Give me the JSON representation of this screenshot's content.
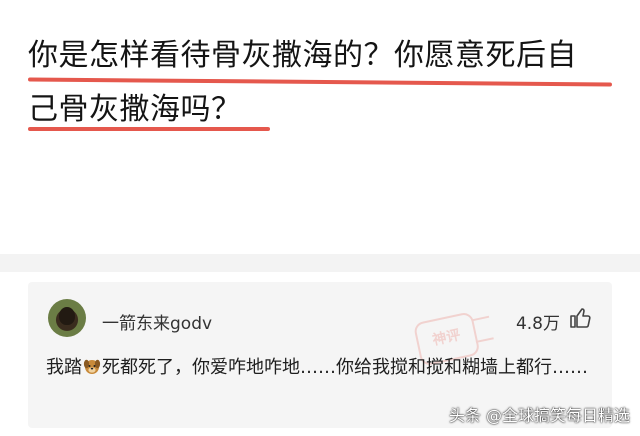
{
  "question": {
    "line1": "你是怎样看待骨灰撒海的？你愿意死后自",
    "line2": "己骨灰撒海吗？"
  },
  "comment": {
    "username": "一箭东来godv",
    "like_count": "4.8万",
    "text_before_icon": "我踏",
    "text_after_icon": "死都死了，你爱咋地咋地……你给我搅和搅和糊墙上都行……",
    "badge_text": "神评"
  },
  "source_watermark": "头条 @全球搞笑每日精选",
  "colors": {
    "accent_underline": "#e5584d",
    "comment_background": "#f5f5f5",
    "text_primary": "#141414"
  },
  "icons": {
    "like": "thumbs-up-icon",
    "inline_emoji": "dog-icon",
    "avatar": "user-avatar"
  }
}
